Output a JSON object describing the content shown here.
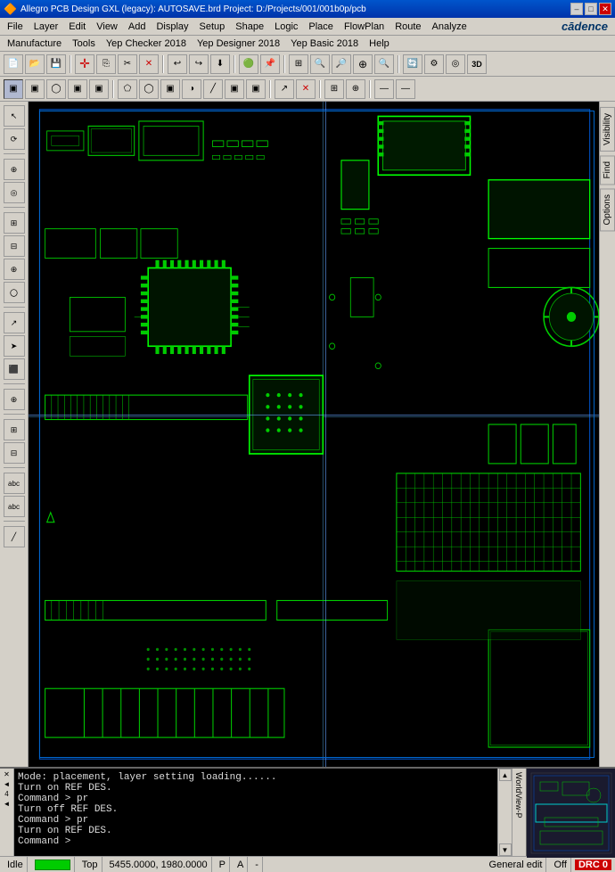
{
  "titlebar": {
    "text": "Allegro PCB Design GXL (legacy): AUTOSAVE.brd  Project: D:/Projects/001/001b0p/pcb",
    "min_label": "–",
    "max_label": "□",
    "close_label": "✕"
  },
  "menubar": {
    "items": [
      "File",
      "Layer",
      "Edit",
      "View",
      "Add",
      "Display",
      "Setup",
      "Shape",
      "Logic",
      "Place",
      "FlowPlan",
      "Route",
      "Analyze",
      "Manufacture",
      "Tools",
      "Yep Checker 2018",
      "Yep Designer 2018",
      "Yep Basic 2018",
      "Help"
    ]
  },
  "cadence_logo": "cādence",
  "toolbar1": {
    "buttons": [
      "📂",
      "💾",
      "🖨",
      "✂",
      "📋",
      "↩",
      "↪",
      "⬇",
      "🔴",
      "📌",
      "▶",
      "🔲",
      "🔲",
      "🔲",
      "🔲",
      "🔲",
      "🔲",
      "🔲",
      "🔲",
      "🔲",
      "🔲",
      "3D"
    ]
  },
  "toolbar2": {
    "buttons": [
      "▣",
      "▣",
      "◯",
      "▣",
      "▣",
      "▣",
      "▣",
      "◯",
      "▣",
      "▣",
      "◯",
      "▣",
      "▣",
      "▣",
      "▣",
      "✕",
      "▣",
      "▣",
      "▣",
      "—",
      "—"
    ]
  },
  "left_toolbar": {
    "buttons": [
      "↖",
      "⟳",
      "⊕",
      "◎",
      "⊞",
      "⊟",
      "⊕",
      "〇",
      "⊟",
      "↗",
      "➤",
      "⬛",
      "⊕",
      "abc",
      "abc"
    ]
  },
  "right_panel": {
    "tabs": [
      "Visibility",
      "Find",
      "Options"
    ]
  },
  "console": {
    "lines": [
      "Mode: placement, layer setting loading......",
      "Turn on REF DES.",
      "Command > pr",
      "Turn off REF DES.",
      "Command > pr",
      "Turn on REF DES.",
      "Command >"
    ]
  },
  "statusbar": {
    "idle": "Idle",
    "indicator": "",
    "layer": "Top",
    "coordinates": "5455.0000, 1980.0000",
    "p_label": "P",
    "a_label": "A",
    "divider": "-",
    "mode": "General edit",
    "off_label": "Off",
    "drc_label": "DRC",
    "drc_count": "0"
  }
}
